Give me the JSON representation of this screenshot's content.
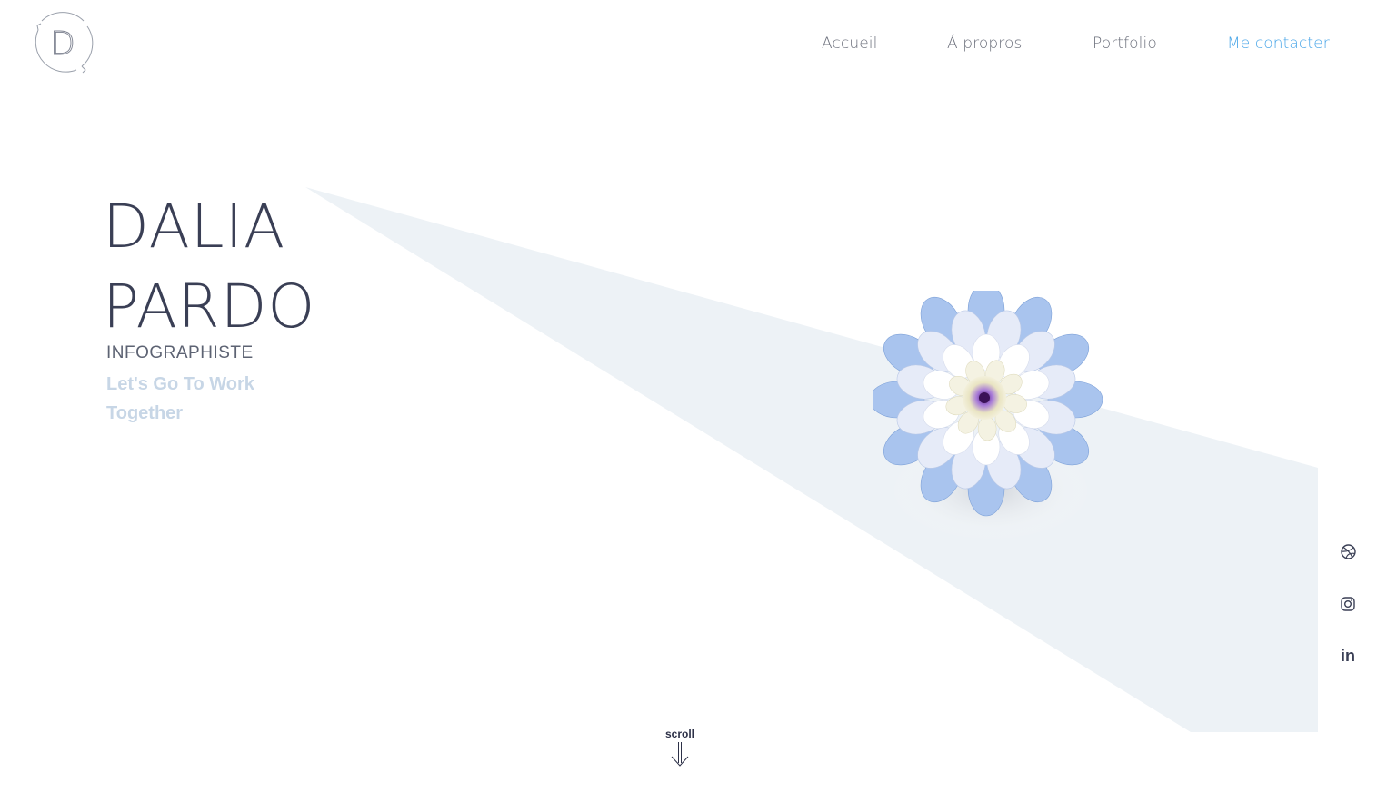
{
  "logo": {
    "letter": "D"
  },
  "nav": {
    "items": [
      {
        "label": "Accueil"
      },
      {
        "label": "Á propros"
      },
      {
        "label": "Portfolio"
      },
      {
        "label": "Me contacter"
      }
    ]
  },
  "hero": {
    "first_name": "DALIA",
    "last_name": "PARDO",
    "role": "INFOGRAPHISTE",
    "tagline_line1": "Let's Go To Work",
    "tagline_line2": "Together"
  },
  "social": {
    "dribbble_icon": "dribbble-icon",
    "instagram_icon": "instagram-icon",
    "linkedin_label": "in"
  },
  "scroll": {
    "label": "scroll"
  },
  "colors": {
    "accent": "#4aa6e8",
    "text_dark": "#3a3f55",
    "tagline": "#c7d6e6",
    "beam": "#edf2f6"
  }
}
